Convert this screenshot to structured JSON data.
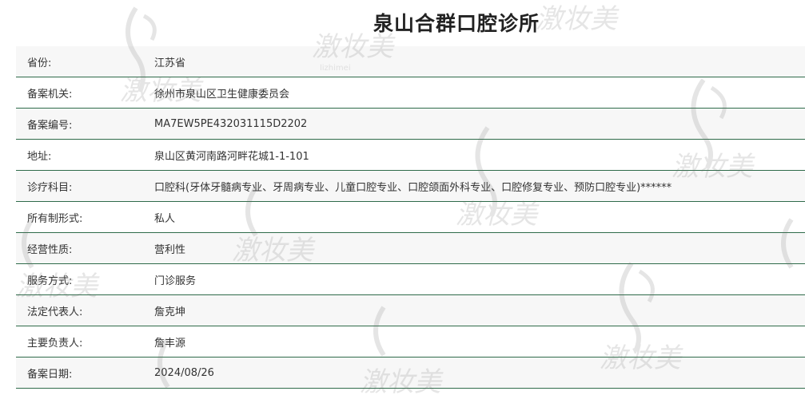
{
  "title": "泉山合群口腔诊所",
  "rows": [
    {
      "label": "省份:",
      "value": "江苏省"
    },
    {
      "label": "备案机关:",
      "value": "徐州市泉山区卫生健康委员会"
    },
    {
      "label": "备案编号:",
      "value": "MA7EW5PE432031115D2202"
    },
    {
      "label": "地址:",
      "value": "泉山区黄河南路河畔花城1-1-101"
    },
    {
      "label": "诊疗科目:",
      "value": "口腔科(牙体牙髓病专业、牙周病专业、儿童口腔专业、口腔颌面外科专业、口腔修复专业、预防口腔专业)******"
    },
    {
      "label": "所有制形式:",
      "value": "私人"
    },
    {
      "label": "经营性质:",
      "value": "营利性"
    },
    {
      "label": "服务方式:",
      "value": "门诊服务"
    },
    {
      "label": "法定代表人:",
      "value": "詹克坤"
    },
    {
      "label": "主要负责人:",
      "value": "詹丰源"
    },
    {
      "label": "备案日期:",
      "value": "2024/08/26"
    }
  ],
  "watermark": {
    "text": "激妆美",
    "subtext": "lizhimei"
  }
}
